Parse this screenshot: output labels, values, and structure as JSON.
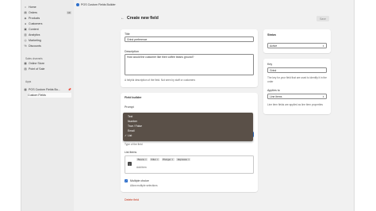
{
  "sidebar": {
    "items": [
      {
        "label": "Home",
        "icon": "home-icon",
        "glyph": "⌂"
      },
      {
        "label": "Orders",
        "icon": "orders-icon",
        "glyph": "▤",
        "badge": "10"
      },
      {
        "label": "Products",
        "icon": "products-icon",
        "glyph": "◈"
      },
      {
        "label": "Customers",
        "icon": "customers-icon",
        "glyph": "●"
      },
      {
        "label": "Content",
        "icon": "content-icon",
        "glyph": "▣"
      },
      {
        "label": "Analytics",
        "icon": "analytics-icon",
        "glyph": "▥"
      },
      {
        "label": "Marketing",
        "icon": "marketing-icon",
        "glyph": "◎"
      },
      {
        "label": "Discounts",
        "icon": "discounts-icon",
        "glyph": "%"
      }
    ],
    "sales_channels_heading": "Sales channels",
    "sales_channels": [
      {
        "label": "Online Store",
        "icon": "store-icon",
        "glyph": "▦"
      },
      {
        "label": "Point of Sale",
        "icon": "pos-icon",
        "glyph": "▧"
      }
    ],
    "apps_heading": "Apps",
    "apps": [
      {
        "label": "POS Custom Fields Bu...",
        "icon": "app-icon",
        "glyph": "▩",
        "pin": "📌"
      }
    ],
    "app_subitem": "Custom Fields"
  },
  "topbar": {
    "app_name": "POS Custom Fields Builder"
  },
  "header": {
    "back": "←",
    "title": "Create new field",
    "save_label": "Save"
  },
  "field_card": {
    "title_label": "Title",
    "title_value": "Grind preference",
    "description_label": "Description",
    "description_value": "How would the customer like their coffee beans ground?",
    "description_help": "A helpful description of the field. Not seen by staff or customers"
  },
  "builder_card": {
    "heading": "Field builder",
    "prompt_label": "Prompt",
    "type_help": "Type of the field",
    "list_items_label": "List items",
    "chips": [
      "Beans",
      "Filter",
      "Plunger",
      "Espresso"
    ],
    "chip_remove": "×",
    "add_item_placeholder": "Add item",
    "multiple_choice_label": "Multiple choice",
    "multiple_choice_help": "Allow multiple selections"
  },
  "dropdown": {
    "options": [
      "Text",
      "Number",
      "True / False",
      "Email",
      "List"
    ],
    "selected": "List",
    "check": "✓"
  },
  "status_card": {
    "heading": "Status",
    "value": "Active"
  },
  "key_card": {
    "key_label": "Key",
    "key_value": "Grind",
    "key_help": "The key for your field that are used to identify it in the order",
    "applies_label": "Applies to",
    "applies_value": "Line items",
    "applies_help": "Line item fields are applied as line item properties"
  },
  "delete_label": "Delete field",
  "colors": {
    "accent": "#2c6ecb",
    "danger": "#c5280c",
    "dropdown_bg": "#5a5048"
  }
}
